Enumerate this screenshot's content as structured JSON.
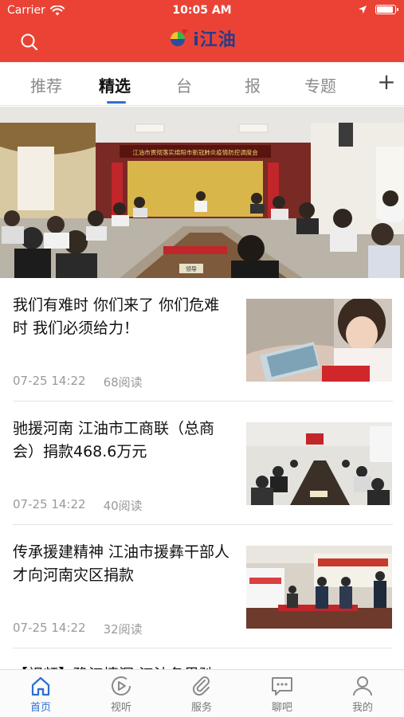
{
  "status_bar": {
    "carrier": "Carrier",
    "time": "10:05 AM"
  },
  "colors": {
    "header_red": "#ea4336",
    "accent_blue": "#2c6fd1",
    "logo_blue": "#1d3f8e"
  },
  "header": {
    "logo_text": "i江油",
    "search_icon": "search-icon"
  },
  "tabs": [
    {
      "label": "推荐",
      "active": false
    },
    {
      "label": "精选",
      "active": true
    },
    {
      "label": "台",
      "active": false
    },
    {
      "label": "报",
      "active": false
    },
    {
      "label": "专题",
      "active": false
    }
  ],
  "tab_add_label": "+",
  "hero": {
    "banner_text": "江油市贯彻落实绵阳市新冠肺炎疫情防控调度会",
    "table_sign": "领导"
  },
  "news": [
    {
      "title": "我们有难时 你们来了 你们危难时 我们必须给力！",
      "date": "07-25 14:22",
      "reads": "68阅读"
    },
    {
      "title": "驰援河南 江油市工商联（总商会）捐款468.6万元",
      "date": "07-25 14:22",
      "reads": "40阅读"
    },
    {
      "title": "传承援建精神 江油市援彝干部人才向河南灾区捐款",
      "date": "07-25 14:22",
      "reads": "32阅读"
    }
  ],
  "partial_item_title": "【视频】豫江情深 江油各界驰",
  "bottom_nav": [
    {
      "label": "首页",
      "icon": "home-icon",
      "active": true
    },
    {
      "label": "视听",
      "icon": "play-icon",
      "active": false
    },
    {
      "label": "服务",
      "icon": "paperclip-icon",
      "active": false
    },
    {
      "label": "聊吧",
      "icon": "chat-icon",
      "active": false
    },
    {
      "label": "我的",
      "icon": "user-icon",
      "active": false
    }
  ]
}
